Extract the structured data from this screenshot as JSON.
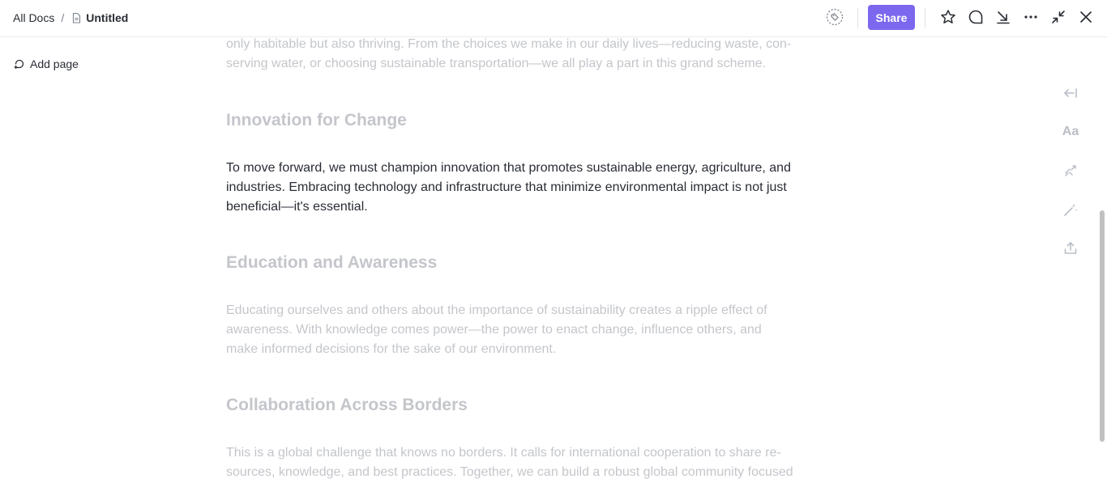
{
  "breadcrumb": {
    "root": "All Docs",
    "separator": "/",
    "current": "Untitled"
  },
  "toolbar": {
    "share_label": "Share",
    "accent_color": "#7b68ee"
  },
  "sidebar": {
    "add_page_label": "Add page"
  },
  "document": {
    "intro_line_1": "only habitable but also thriving. From the choices we make in our daily lives—reducing waste, con-",
    "intro_line_2": "serving water, or choosing sustainable transportation—we all play a part in this grand scheme.",
    "sections": [
      {
        "heading": "Innovation for Change",
        "body": "To move forward, we must champion innovation that promotes sustainable energy, agriculture, and industries. Embracing technology and infrastructure that minimize environmental impact is not just beneficial—it's essential."
      },
      {
        "heading": "Education and Awareness",
        "body": "Educating ourselves and others about the importance of sustainability creates a ripple effect of awareness. With knowledge comes power—the power to enact change, influence others, and make informed decisions for the sake of our environment."
      },
      {
        "heading": "Collaboration Across Borders",
        "body_line_1": "This is a global challenge that knows no borders. It calls for international cooperation to share re-",
        "body_line_2": "sources, knowledge, and best practices. Together, we can build a robust global community focused"
      }
    ]
  },
  "right_rail": {
    "font_label": "Aa"
  },
  "icons": [
    "doc-icon",
    "tag-icon",
    "star-icon",
    "comment-icon",
    "download-icon",
    "more-icon",
    "collapse-icon",
    "close-icon",
    "add-page-icon",
    "collapse-left-icon",
    "convert-icon",
    "magic-wand-icon",
    "export-icon"
  ]
}
